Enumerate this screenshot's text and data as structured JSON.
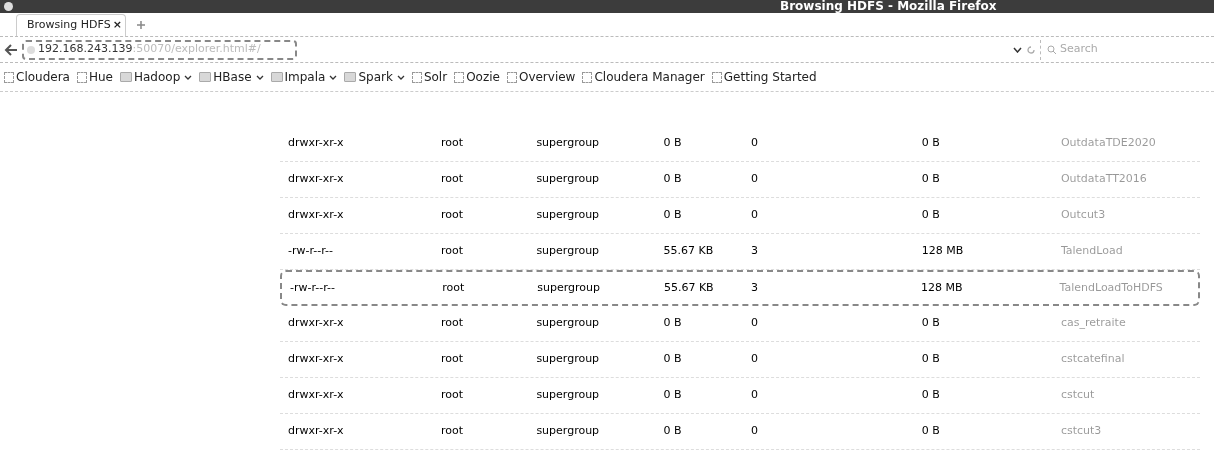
{
  "window": {
    "title": "Browsing HDFS - Mozilla Firefox"
  },
  "tabs": [
    {
      "label": "Browsing HDFS",
      "selected": true,
      "close": "×"
    }
  ],
  "address_bar": {
    "host": "192.168.243.139",
    "path": ":50070/explorer.html#/",
    "highlighted": true
  },
  "search": {
    "placeholder": "Search"
  },
  "bookmarks": [
    {
      "label": "Cloudera",
      "kind": "page"
    },
    {
      "label": "Hue",
      "kind": "page"
    },
    {
      "label": "Hadoop",
      "kind": "folder"
    },
    {
      "label": "HBase",
      "kind": "folder"
    },
    {
      "label": "Impala",
      "kind": "folder"
    },
    {
      "label": "Spark",
      "kind": "folder"
    },
    {
      "label": "Solr",
      "kind": "page"
    },
    {
      "label": "Oozie",
      "kind": "page"
    },
    {
      "label": "Overview",
      "kind": "page"
    },
    {
      "label": "Cloudera Manager",
      "kind": "page"
    },
    {
      "label": "Getting Started",
      "kind": "page"
    }
  ],
  "table": {
    "rows": [
      {
        "permission": "drwxr-xr-x",
        "owner": "root",
        "group": "supergroup",
        "size": "0 B",
        "replication": "0",
        "block_size": "0 B",
        "name": "OutdataTDE2020",
        "highlighted": false
      },
      {
        "permission": "drwxr-xr-x",
        "owner": "root",
        "group": "supergroup",
        "size": "0 B",
        "replication": "0",
        "block_size": "0 B",
        "name": "OutdataTT2016",
        "highlighted": false
      },
      {
        "permission": "drwxr-xr-x",
        "owner": "root",
        "group": "supergroup",
        "size": "0 B",
        "replication": "0",
        "block_size": "0 B",
        "name": "Outcut3",
        "highlighted": false
      },
      {
        "permission": "-rw-r--r--",
        "owner": "root",
        "group": "supergroup",
        "size": "55.67 KB",
        "replication": "3",
        "block_size": "128 MB",
        "name": "TalendLoad",
        "highlighted": false
      },
      {
        "permission": "-rw-r--r--",
        "owner": "root",
        "group": "supergroup",
        "size": "55.67 KB",
        "replication": "3",
        "block_size": "128 MB",
        "name": "TalendLoadToHDFS",
        "highlighted": true
      },
      {
        "permission": "drwxr-xr-x",
        "owner": "root",
        "group": "supergroup",
        "size": "0 B",
        "replication": "0",
        "block_size": "0 B",
        "name": "cas_retraite",
        "highlighted": false
      },
      {
        "permission": "drwxr-xr-x",
        "owner": "root",
        "group": "supergroup",
        "size": "0 B",
        "replication": "0",
        "block_size": "0 B",
        "name": "cstcatefinal",
        "highlighted": false
      },
      {
        "permission": "drwxr-xr-x",
        "owner": "root",
        "group": "supergroup",
        "size": "0 B",
        "replication": "0",
        "block_size": "0 B",
        "name": "cstcut",
        "highlighted": false
      },
      {
        "permission": "drwxr-xr-x",
        "owner": "root",
        "group": "supergroup",
        "size": "0 B",
        "replication": "0",
        "block_size": "0 B",
        "name": "cstcut3",
        "highlighted": false
      }
    ]
  }
}
